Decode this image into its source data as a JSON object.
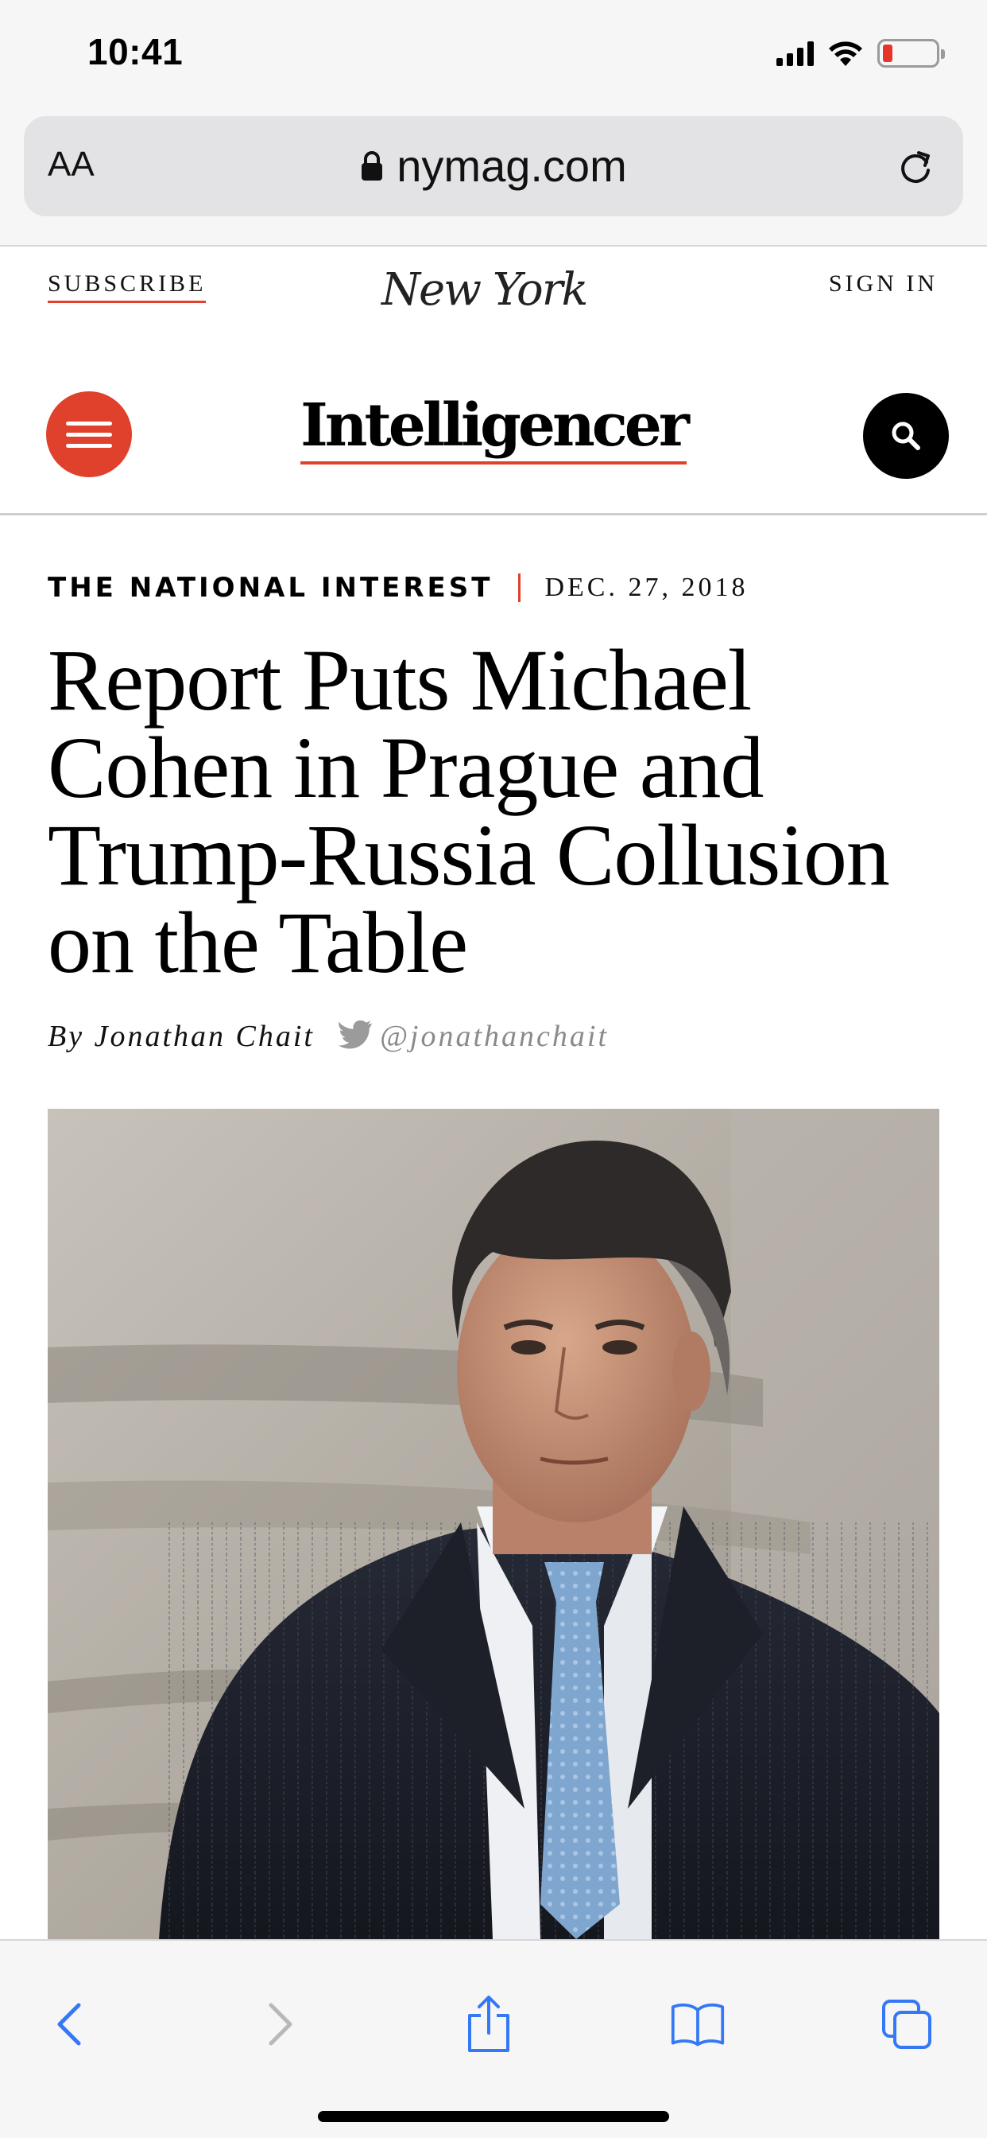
{
  "status_bar": {
    "time": "10:41",
    "battery_level": 0.1,
    "battery_color": "#e5352a"
  },
  "browser": {
    "text_size_label": "AA",
    "url": "nymag.com",
    "icons": [
      "lock-icon",
      "reload-icon"
    ]
  },
  "site_header": {
    "subscribe_label": "SUBSCRIBE",
    "sign_in_label": "SIGN IN",
    "publication_logo_text": "NEW YORK",
    "section_logo_text": "Intelligencer",
    "accent_color": "#e0412d"
  },
  "article": {
    "rubric": "THE NATIONAL INTEREST",
    "date": "DEC. 27, 2018",
    "headline": "Report Puts Michael Cohen in Prague and Trump-Russia Collusion on the Table",
    "byline": "By Jonathan Chait",
    "twitter_handle": "@jonathanchait",
    "lead_image": "photo-man-in-pinstripe-overcoat-blue-tie-against-stone-column"
  },
  "toolbar": {
    "icons": [
      "back-icon",
      "forward-icon",
      "share-icon",
      "bookmarks-icon",
      "tabs-icon"
    ],
    "forward_enabled": false,
    "icon_color": "#3478f6"
  }
}
